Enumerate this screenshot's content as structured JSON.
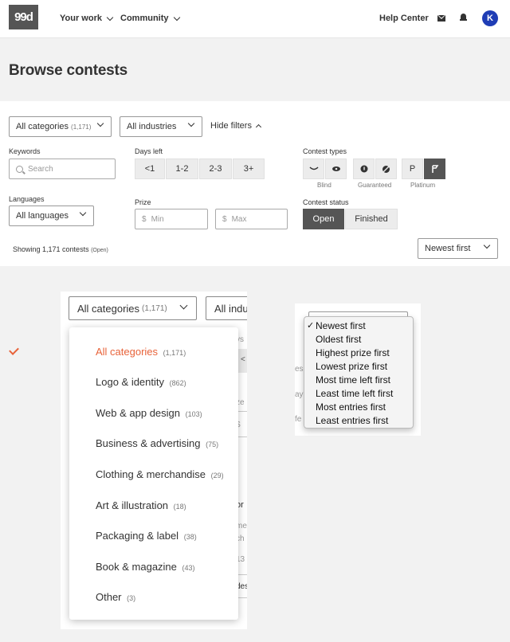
{
  "header": {
    "logo": "99d",
    "nav": [
      "Your work",
      "Community"
    ],
    "help": "Help Center",
    "avatar_initial": "K"
  },
  "page_title": "Browse contests",
  "filters": {
    "category": {
      "label": "All categories",
      "count": "(1,171)"
    },
    "industry": {
      "label": "All industries"
    },
    "hide_filters": "Hide filters",
    "keywords_label": "Keywords",
    "search_placeholder": "Search",
    "days_left_label": "Days left",
    "days_left_options": [
      "<1",
      "1-2",
      "2-3",
      "3+"
    ],
    "contest_types_label": "Contest types",
    "type_captions": [
      "Blind",
      "Guaranteed",
      "Platinum"
    ],
    "platinum_letter": "P",
    "languages_label": "Languages",
    "languages_value": "All languages",
    "prize_label": "Prize",
    "prize_min": "Min",
    "prize_max": "Max",
    "currency": "$",
    "status_label": "Contest status",
    "status_options": [
      "Open",
      "Finished"
    ],
    "showing_text": "Showing 1,171 contests",
    "showing_state": "(Open)",
    "sort_value": "Newest first"
  },
  "zoom": {
    "category_select": {
      "label": "All categories",
      "count": "(1,171)"
    },
    "industry_partial": "All indu",
    "ghost_texts": [
      "ys",
      "<",
      "ze",
      "$",
      "or",
      "me",
      "ch",
      "13",
      "des"
    ],
    "category_options": [
      {
        "label": "All categories",
        "count": "(1,171)",
        "selected": true
      },
      {
        "label": "Logo & identity",
        "count": "(862)"
      },
      {
        "label": "Web & app design",
        "count": "(103)"
      },
      {
        "label": "Business & advertising",
        "count": "(75)"
      },
      {
        "label": "Clothing & merchandise",
        "count": "(29)"
      },
      {
        "label": "Art & illustration",
        "count": "(18)"
      },
      {
        "label": "Packaging & label",
        "count": "(38)"
      },
      {
        "label": "Book & magazine",
        "count": "(43)"
      },
      {
        "label": "Other",
        "count": "(3)"
      }
    ],
    "sort_check": "✓",
    "sort_ghosts": [
      "es",
      "ay",
      "fe"
    ],
    "sort_options": [
      "Newest first",
      "Oldest first",
      "Highest prize first",
      "Lowest prize first",
      "Most time left first",
      "Least time left first",
      "Most entries first",
      "Least entries first"
    ]
  }
}
